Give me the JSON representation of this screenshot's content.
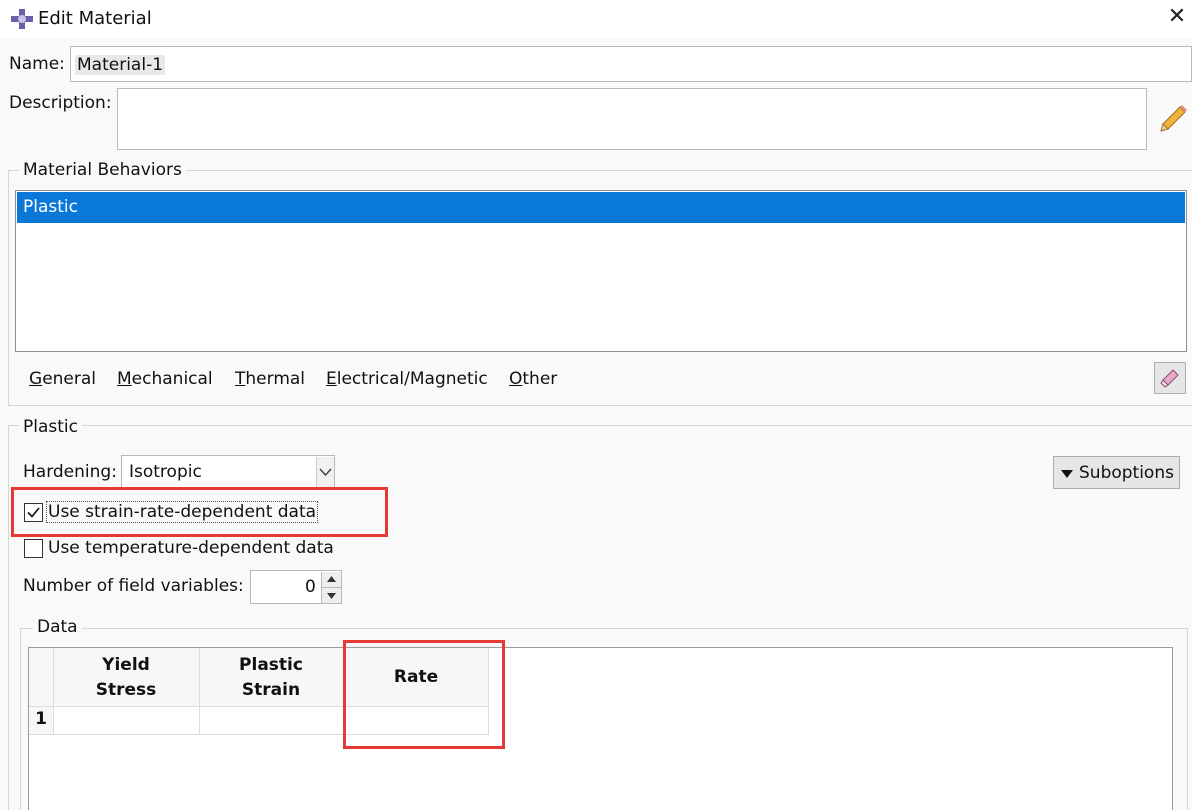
{
  "window": {
    "title": "Edit Material",
    "close_icon": "close-icon"
  },
  "name": {
    "label": "Name:",
    "value": "Material-1"
  },
  "description": {
    "label": "Description:",
    "value": ""
  },
  "behaviors": {
    "group_label": "Material Behaviors",
    "items": [
      "Plastic"
    ],
    "selected": "Plastic"
  },
  "menu": {
    "general": {
      "first": "G",
      "rest": "eneral"
    },
    "mechanical": {
      "first": "M",
      "rest": "echanical"
    },
    "thermal": {
      "first": "T",
      "rest": "hermal"
    },
    "electrical": {
      "first": "E",
      "rest": "lectrical/Magnetic"
    },
    "other": {
      "first": "O",
      "rest": "ther"
    }
  },
  "plastic": {
    "group_label": "Plastic",
    "hardening_label": "Hardening:",
    "hardening_value": "Isotropic",
    "suboptions_label": "Suboptions",
    "strain_rate_label": "Use strain-rate-dependent data",
    "strain_rate_checked": true,
    "temperature_label": "Use temperature-dependent data",
    "temperature_checked": false,
    "field_vars_label": "Number of field variables:",
    "field_vars_value": "0"
  },
  "data": {
    "group_label": "Data",
    "columns": [
      {
        "line1": "Yield",
        "line2": "Stress"
      },
      {
        "line1": "Plastic",
        "line2": "Strain"
      },
      {
        "line1": "Rate",
        "line2": ""
      }
    ],
    "rows": [
      {
        "index": "1",
        "cells": [
          "",
          "",
          ""
        ]
      }
    ]
  },
  "colors": {
    "selection": "#0a78d7",
    "highlight": "#e53935"
  }
}
